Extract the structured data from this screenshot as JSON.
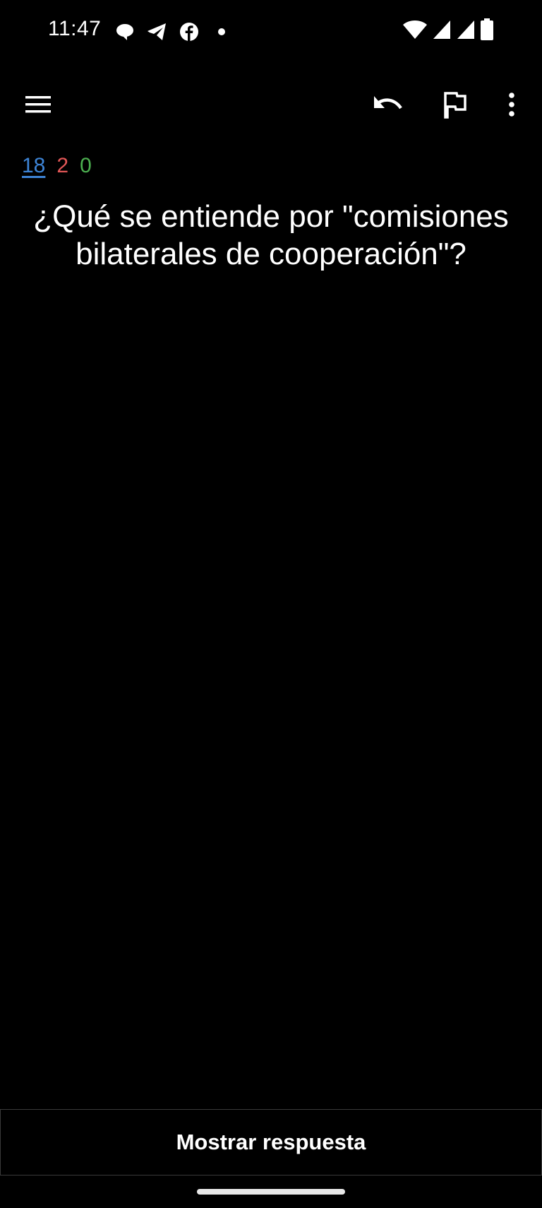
{
  "status_bar": {
    "time": "11:47",
    "notification_icons": [
      "chat-bubble-icon",
      "telegram-icon",
      "facebook-icon",
      "dot-icon"
    ],
    "system_icons": [
      "wifi-icon",
      "signal-icon",
      "signal-icon",
      "battery-icon"
    ]
  },
  "toolbar": {
    "menu_icon": "hamburger-menu-icon",
    "undo_icon": "undo-icon",
    "flag_icon": "flag-icon",
    "more_icon": "more-vert-icon"
  },
  "counts": {
    "new": "18",
    "learning": "2",
    "review": "0",
    "colors": {
      "new": "#3d84d6",
      "learning": "#e35757",
      "review": "#4caf50"
    }
  },
  "card": {
    "question": "¿Qué se entiende por \"comisiones bilaterales de cooperación\"?"
  },
  "answer_button": {
    "label": "Mostrar respuesta"
  },
  "colors": {
    "background": "#000000",
    "text": "#ffffff",
    "button_border": "#3a3a3a"
  }
}
